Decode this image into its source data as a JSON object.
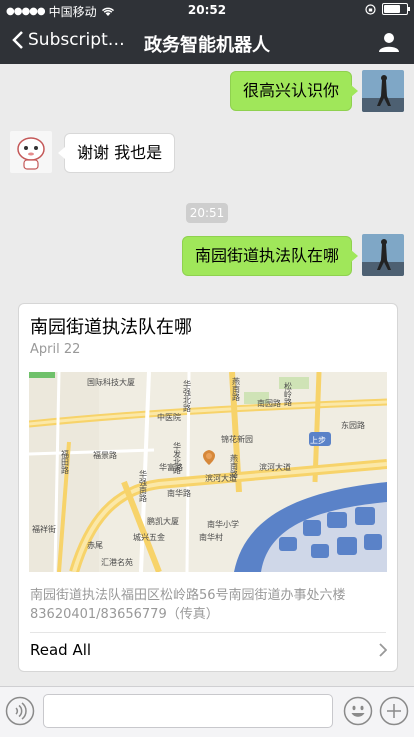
{
  "status_bar": {
    "carrier": "中国移动",
    "time": "20:52",
    "battery_level": 0.8
  },
  "nav": {
    "back_label": "Subscript…",
    "title": "政务智能机器人"
  },
  "messages": [
    {
      "from": "me",
      "text": "很高兴认识你"
    },
    {
      "from": "bot",
      "text": "谢谢 我也是"
    },
    {
      "from": "me",
      "text": "南园街道执法队在哪"
    }
  ],
  "timestamp": "20:51",
  "card": {
    "title": "南园街道执法队在哪",
    "date": "April 22",
    "description": "南园街道执法队福田区松岭路56号南园街道办事处六楼83620401/83656779（传真）",
    "read_all": "Read All"
  },
  "map_labels": {
    "l1": "国际科技大厦",
    "l2": "中医院",
    "l3": "锦花新园",
    "l4": "南园路",
    "l5": "东园路",
    "l6": "福景路",
    "l7": "福田路",
    "l8": "华强北路",
    "l9": "华富路",
    "l10": "华发北路",
    "l11": "燕南路",
    "l12": "滨河大道",
    "l13": "上步",
    "l14": "南华路",
    "l15": "鹏凯大厦",
    "l16": "南华小学",
    "l17": "城兴五金",
    "l18": "南华村",
    "l19": "赤尾",
    "l20": "汇港名苑",
    "l21": "松岭路",
    "l22": "华强南路",
    "l23": "燕南路",
    "l24": "福祥街"
  },
  "colors": {
    "chat_bg": "#ebebeb",
    "nav_bg": "#2f3237",
    "my_bubble": "#a0e75a",
    "water": "#5a82c8"
  }
}
